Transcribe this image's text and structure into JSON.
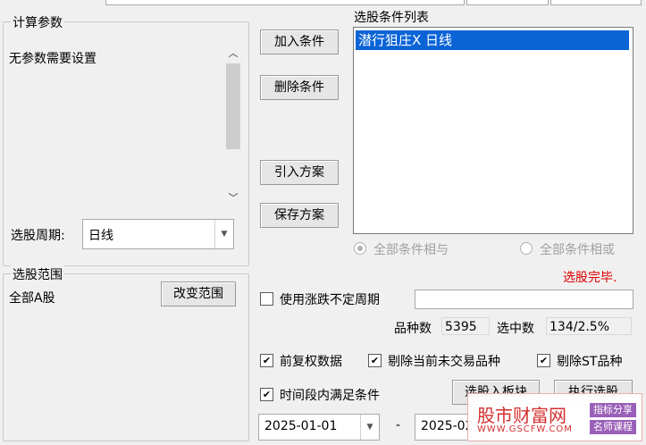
{
  "calc_params": {
    "title": "计算参数",
    "message": "无参数需要设置"
  },
  "period": {
    "label": "选股周期:",
    "value": "日线"
  },
  "scope": {
    "title": "选股范围",
    "value": "全部A股",
    "change_button": "改变范围"
  },
  "buttons": {
    "add_condition": "加入条件",
    "remove_condition": "删除条件",
    "import_plan": "引入方案",
    "save_plan": "保存方案",
    "to_block": "选股入板块",
    "execute": "执行选股"
  },
  "condition_list": {
    "title": "选股条件列表",
    "items": [
      "潜行狙庄X  日线"
    ]
  },
  "logic": {
    "and_label": "全部条件相与",
    "or_label": "全部条件相或",
    "selected": "and"
  },
  "status": {
    "text": "选股完毕.",
    "color": "#e00000"
  },
  "options": {
    "use_variable_period": "使用涨跌不定周期",
    "forward_adjust": "前复权数据",
    "exclude_untraded": "剔除当前未交易品种",
    "exclude_st": "剔除ST品种",
    "period_within": "时间段内满足条件"
  },
  "stats": {
    "count_label": "品种数",
    "count_value": "5395",
    "selected_label": "选中数",
    "selected_value": "134/2.5%"
  },
  "dates": {
    "start": "2025-01-01",
    "separator": "-",
    "end": "2025-02"
  },
  "watermark": {
    "site_name": "股市财富网",
    "url": "WWW.GSCFW.COM",
    "tag1": "指标分享",
    "tag2": "名师课程"
  },
  "colors": {
    "selection": "#0a64d6",
    "accent_red": "#e00000",
    "watermark": "#d32f2f"
  }
}
